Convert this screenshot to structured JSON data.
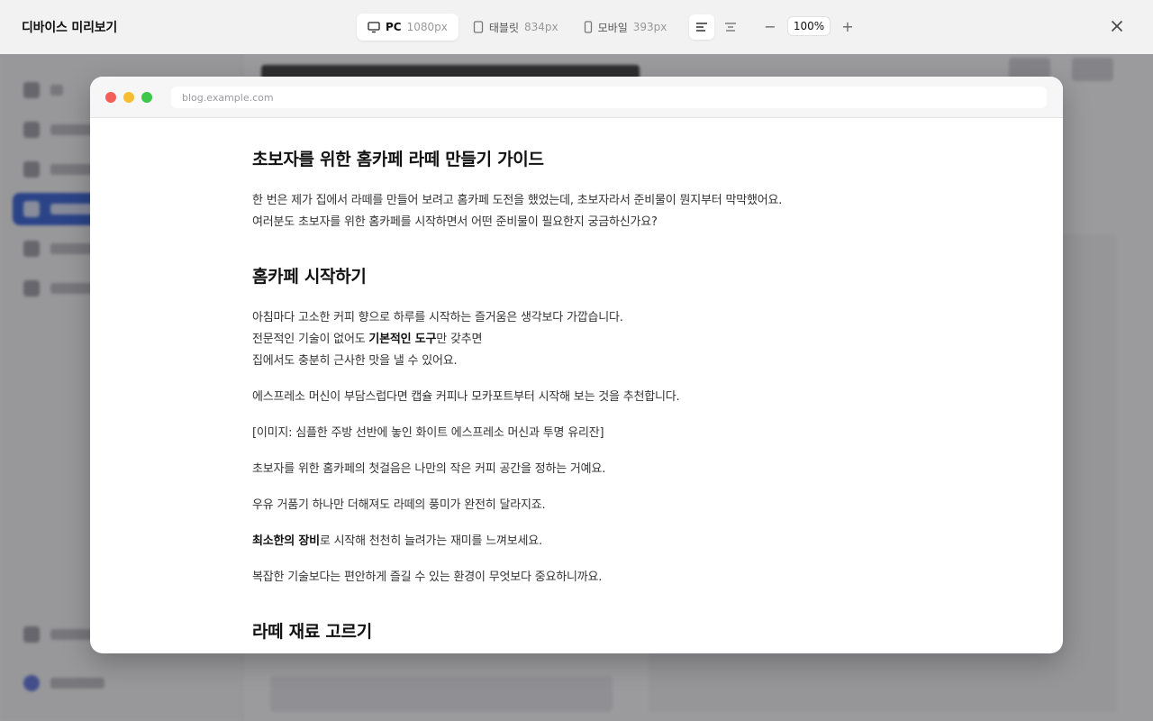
{
  "app": {
    "title": "디바이스 미리보기"
  },
  "devices": [
    {
      "name": "PC",
      "px": "1080px",
      "active": true
    },
    {
      "name": "태블릿",
      "px": "834px",
      "active": false
    },
    {
      "name": "모바일",
      "px": "393px",
      "active": false
    }
  ],
  "zoom": {
    "value": "100%",
    "minus": "−",
    "plus": "+"
  },
  "browser": {
    "url": "blog.example.com"
  },
  "article": {
    "title": "초보자를 위한 홈카페 라떼 만들기 가이드",
    "intro_1": "한 번은 제가 집에서 라떼를 만들어 보려고 홈카페 도전을 했었는데, 초보자라서 준비물이 뭔지부터 막막했어요.",
    "intro_2": "여러분도 초보자를 위한 홈카페를 시작하면서 어떤 준비물이 필요한지 궁금하신가요?",
    "section1_title": "홈카페 시작하기",
    "s1_p1_l1": "아침마다 고소한 커피 향으로 하루를 시작하는 즐거움은 생각보다 가깝습니다.",
    "s1_p1_l2_pre": "전문적인 기술이 없어도 ",
    "s1_p1_l2_bold": "기본적인 도구",
    "s1_p1_l2_post": "만 갖추면",
    "s1_p1_l3": "집에서도 충분히 근사한 맛을 낼 수 있어요.",
    "s1_p2": "에스프레소 머신이 부담스럽다면 캡슐 커피나 모카포트부터 시작해 보는 것을 추천합니다.",
    "s1_p3": "[이미지: 심플한 주방 선반에 놓인 화이트 에스프레소 머신과 투명 유리잔]",
    "s1_p4": "초보자를 위한 홈카페의 첫걸음은 나만의 작은 커피 공간을 정하는 거예요.",
    "s1_p5": "우유 거품기 하나만 더해져도 라떼의 풍미가 완전히 달라지죠.",
    "s1_p6_bold": "최소한의 장비",
    "s1_p6_post": "로 시작해 천천히 늘려가는 재미를 느껴보세요.",
    "s1_p7": "복잡한 기술보다는 편안하게 즐길 수 있는 환경이 무엇보다 중요하니까요.",
    "section2_title": "라떼 재료 고르기"
  }
}
